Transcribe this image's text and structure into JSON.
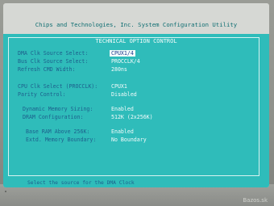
{
  "bios_title": "Chips and Technologies, Inc. System Configuration Utility",
  "section_title": "TECHNICAL OPTION CONTROL",
  "settings": [
    {
      "label": "DMA Clk Source Select:",
      "value": "CPUX1/4",
      "selected": true
    },
    {
      "label": "Bus Clk Source Select:",
      "value": "PROCCLK/4"
    },
    {
      "label": "Refresh CMD Width:",
      "value": "280ns"
    },
    {
      "label": "CPU Clk Select (PROCCLK):",
      "value": "CPUX1"
    },
    {
      "label": "Parity Control:",
      "value": "Disabled"
    },
    {
      "label": "Dynamic Memory Sizing:",
      "value": "Enabled"
    },
    {
      "label": "DRAM Configuration:",
      "value": "512K (2x256K)"
    },
    {
      "label": "Base RAM Above 256K:",
      "value": "Enabled"
    },
    {
      "label": "Extd. Memory Boundary:",
      "value": "No Boundary"
    }
  ],
  "help_text": "Select the source for the DMA Clock",
  "watermark": "Bazos.sk"
}
